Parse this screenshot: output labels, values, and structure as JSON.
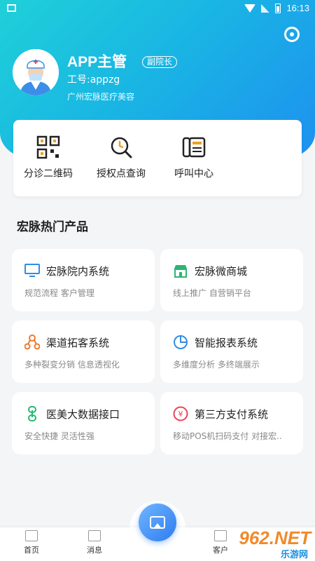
{
  "status_bar": {
    "time": "16:13"
  },
  "profile": {
    "name": "APP主管",
    "role_badge": "副院长",
    "job_no": "工号:appzg",
    "company": "广州宏脉医疗美容"
  },
  "quick_actions": [
    {
      "label": "分诊二维码",
      "icon": "qr-code-icon"
    },
    {
      "label": "授权点查询",
      "icon": "search-clock-icon"
    },
    {
      "label": "呼叫中心",
      "icon": "call-center-icon"
    }
  ],
  "section_title": "宏脉热门产品",
  "products": [
    {
      "title": "宏脉院内系统",
      "subtitle": "规范流程 客户管理",
      "icon": "monitor-icon",
      "color": "#2f8de4"
    },
    {
      "title": "宏脉微商城",
      "subtitle": "线上推广 自营销平台",
      "icon": "shop-icon",
      "color": "#2bb673"
    },
    {
      "title": "渠道拓客系统",
      "subtitle": "多种裂变分销 信息透视化",
      "icon": "network-icon",
      "color": "#f07a2b"
    },
    {
      "title": "智能报表系统",
      "subtitle": "多维度分析 多终端展示",
      "icon": "pie-chart-icon",
      "color": "#2f8de4"
    },
    {
      "title": "医美大数据接口",
      "subtitle": "安全快捷 灵活性强",
      "icon": "data-link-icon",
      "color": "#2bb673"
    },
    {
      "title": "第三方支付系统",
      "subtitle": "移动POS机扫码支付 对接宏..",
      "icon": "yen-icon",
      "color": "#e8445a"
    }
  ],
  "tabs": [
    {
      "label": "首页"
    },
    {
      "label": "消息"
    },
    {
      "label": "客户"
    }
  ],
  "watermark": {
    "top": "962.NET",
    "bottom": "乐游网"
  }
}
